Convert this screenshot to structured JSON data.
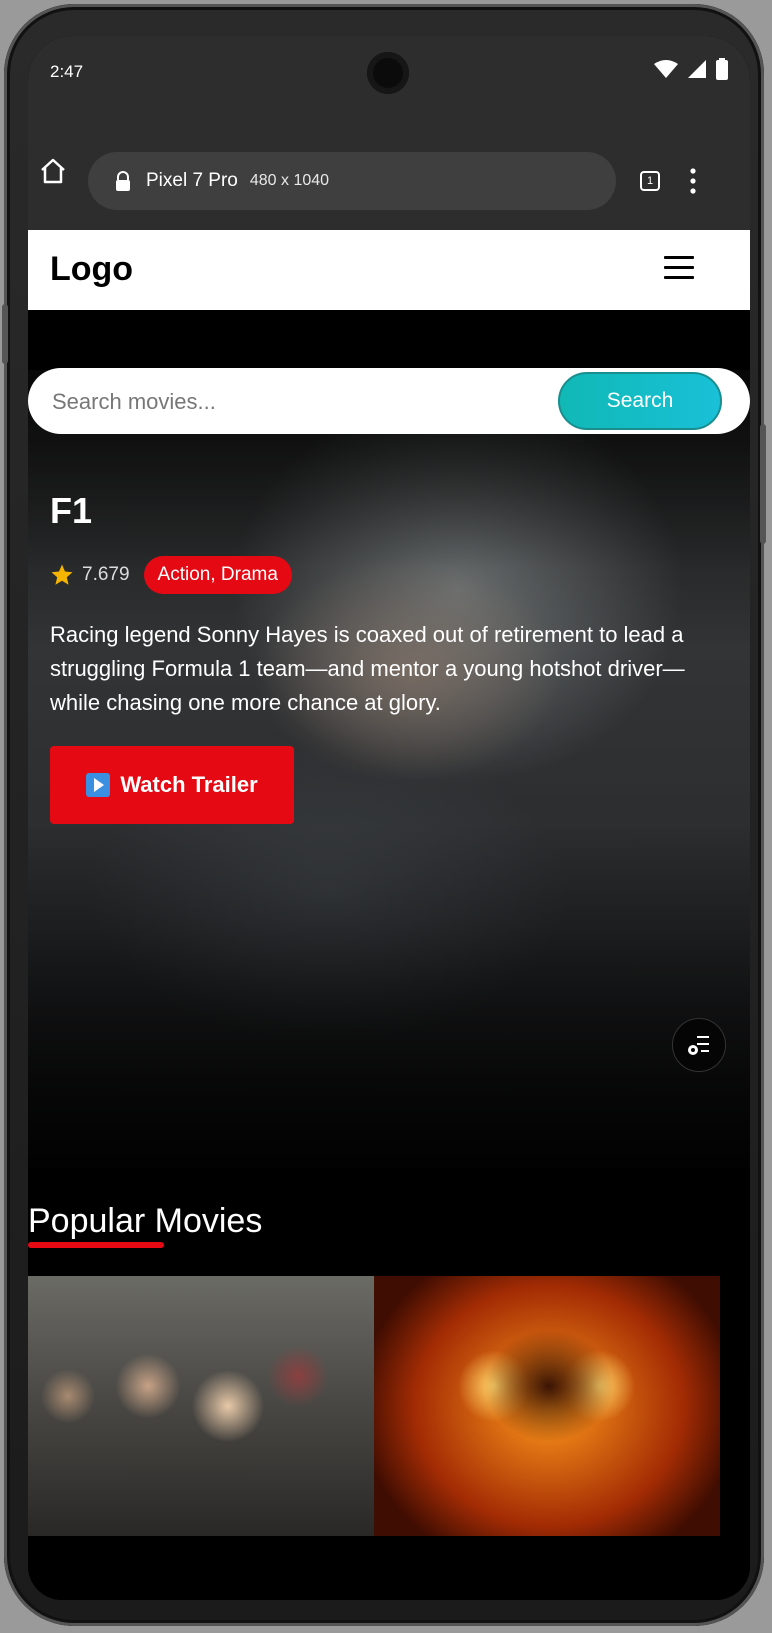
{
  "status_bar": {
    "time": "2:47"
  },
  "browser": {
    "device_name": "Pixel 7 Pro",
    "device_size": "480 x 1040",
    "tab_count": "1"
  },
  "header": {
    "logo": "Logo"
  },
  "search": {
    "placeholder": "Search movies...",
    "button_label": "Search"
  },
  "hero": {
    "title": "F1",
    "rating": "7.679",
    "genres": "Action, Drama",
    "overview": "Racing legend Sonny Hayes is coaxed out of retirement to lead a struggling Formula 1 team—and mentor a young hotshot driver—while chasing one more chance at glory.",
    "trailer_label": "Watch Trailer"
  },
  "popular": {
    "title": "Popular Movies"
  },
  "colors": {
    "accent_red": "#e50914",
    "search_teal": "#10b9b5"
  }
}
